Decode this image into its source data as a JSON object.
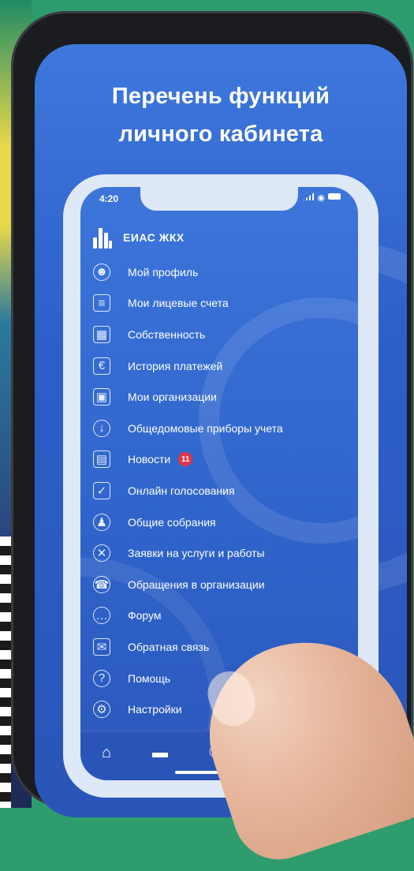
{
  "headline": {
    "line1": "Перечень функций",
    "line2": "личного кабинета"
  },
  "status": {
    "time": "4:20"
  },
  "app": {
    "name": "ЕИАС ЖКХ"
  },
  "menu": [
    {
      "label": "Мой профиль",
      "icon": "user-icon"
    },
    {
      "label": "Мои лицевые счета",
      "icon": "accounts-icon"
    },
    {
      "label": "Собственность",
      "icon": "property-icon"
    },
    {
      "label": "История платежей",
      "icon": "payments-history-icon"
    },
    {
      "label": "Мои организации",
      "icon": "organizations-icon"
    },
    {
      "label": "Общедомовые приборы учета",
      "icon": "meter-icon"
    },
    {
      "label": "Новости",
      "icon": "news-icon",
      "badge": "11"
    },
    {
      "label": "Онлайн голосования",
      "icon": "voting-icon"
    },
    {
      "label": "Общие собрания",
      "icon": "meetings-icon"
    },
    {
      "label": "Заявки на услуги и работы",
      "icon": "tools-icon"
    },
    {
      "label": "Обращения в организации",
      "icon": "phone-icon"
    },
    {
      "label": "Форум",
      "icon": "chat-icon"
    },
    {
      "label": "Обратная связь",
      "icon": "mail-icon"
    },
    {
      "label": "Помощь",
      "icon": "help-icon"
    },
    {
      "label": "Настройки",
      "icon": "settings-icon"
    }
  ],
  "tabs": [
    {
      "icon": "home-icon"
    },
    {
      "icon": "card-icon"
    },
    {
      "icon": "meter-tab-icon"
    }
  ],
  "colors": {
    "accent": "#2f63c9",
    "badge": "#e3344b"
  }
}
